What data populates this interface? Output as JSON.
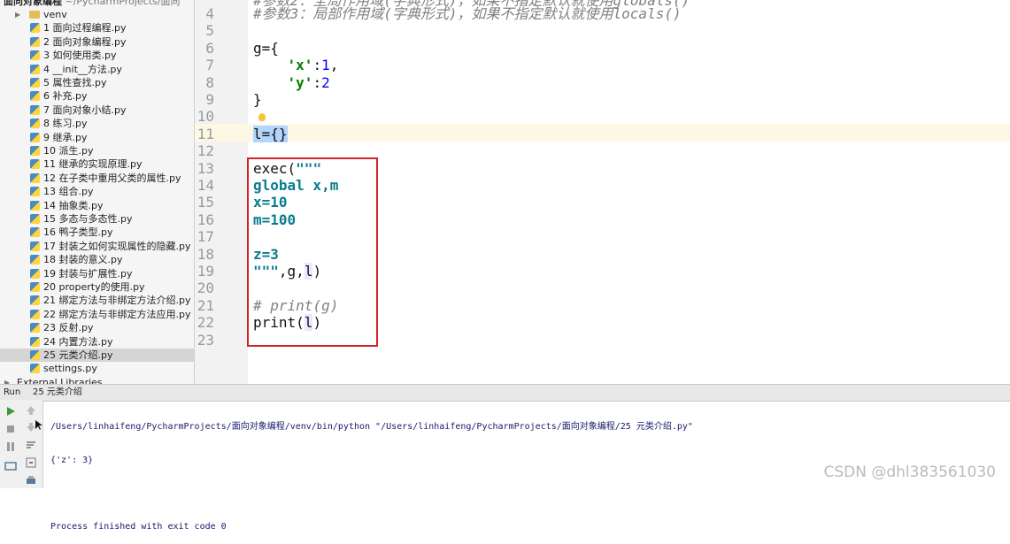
{
  "project": {
    "name": "面向对象编程",
    "path": "~/PycharmProjects/面向"
  },
  "tree": [
    {
      "label": "venv",
      "type": "folder"
    },
    {
      "label": "1 面向过程编程.py",
      "type": "py"
    },
    {
      "label": "2 面向对象编程.py",
      "type": "py"
    },
    {
      "label": "3 如何使用类.py",
      "type": "py"
    },
    {
      "label": "4 __init__方法.py",
      "type": "py"
    },
    {
      "label": "5 属性查找.py",
      "type": "py"
    },
    {
      "label": "6 补充.py",
      "type": "py"
    },
    {
      "label": "7 面向对象小结.py",
      "type": "py"
    },
    {
      "label": "8 练习.py",
      "type": "py"
    },
    {
      "label": "9 继承.py",
      "type": "py"
    },
    {
      "label": "10 派生.py",
      "type": "py"
    },
    {
      "label": "11 继承的实现原理.py",
      "type": "py"
    },
    {
      "label": "12 在子类中重用父类的属性.py",
      "type": "py"
    },
    {
      "label": "13 组合.py",
      "type": "py"
    },
    {
      "label": "14 抽象类.py",
      "type": "py"
    },
    {
      "label": "15 多态与多态性.py",
      "type": "py"
    },
    {
      "label": "16 鸭子类型.py",
      "type": "py"
    },
    {
      "label": "17 封装之如何实现属性的隐藏.py",
      "type": "py"
    },
    {
      "label": "18 封装的意义.py",
      "type": "py"
    },
    {
      "label": "19 封装与扩展性.py",
      "type": "py"
    },
    {
      "label": "20 property的使用.py",
      "type": "py"
    },
    {
      "label": "21 绑定方法与非绑定方法介绍.py",
      "type": "py"
    },
    {
      "label": "22 绑定方法与非绑定方法应用.py",
      "type": "py"
    },
    {
      "label": "23 反射.py",
      "type": "py"
    },
    {
      "label": "24 内置方法.py",
      "type": "py"
    },
    {
      "label": "25 元类介绍.py",
      "type": "py",
      "selected": true
    },
    {
      "label": "settings.py",
      "type": "py"
    },
    {
      "label": "External Libraries",
      "type": "lib"
    }
  ],
  "editor": {
    "line_numbers": [
      "4",
      "5",
      "6",
      "7",
      "8",
      "9",
      "10",
      "11",
      "12",
      "13",
      "14",
      "15",
      "16",
      "17",
      "18",
      "19",
      "20",
      "21",
      "22",
      "23"
    ],
    "partial_top": "#参数2：全局作用域(字典形式)，如果不指定默认就使用globals()",
    "lines": [
      "#参数3：局部作用域(字典形式)，如果不指定默认就使用locals()",
      "",
      "g={",
      "    'x':1,",
      "    'y':2",
      "}",
      "",
      "l={}",
      "",
      "exec(\"\"\"",
      "global x,m",
      "x=10",
      "m=100",
      "",
      "z=3",
      "\"\"\",g,l)",
      "",
      "# print(g)",
      "print(l)",
      ""
    ]
  },
  "run": {
    "label": "Run",
    "tab": "25 元类介绍",
    "output": [
      "/Users/linhaifeng/PycharmProjects/面向对象编程/venv/bin/python \"/Users/linhaifeng/PycharmProjects/面向对象编程/25 元类介绍.py\"",
      "{'z': 3}",
      "",
      "Process finished with exit code 0"
    ]
  },
  "watermark": "CSDN @dhl383561030"
}
